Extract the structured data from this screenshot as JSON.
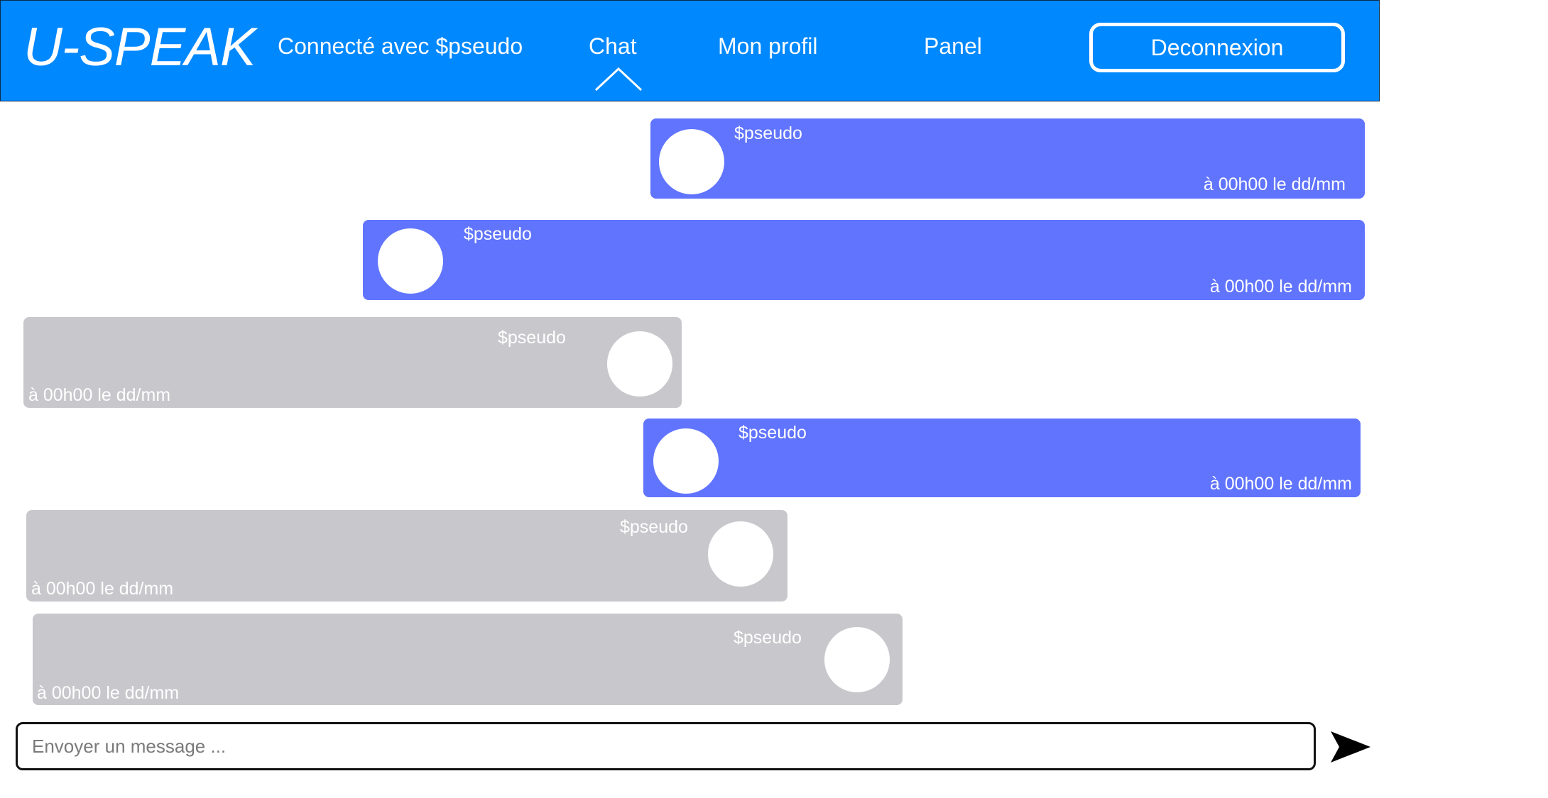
{
  "header": {
    "logo": "U-SPEAK",
    "connected_label": "Connecté avec $pseudo",
    "nav": {
      "chat": "Chat",
      "profile": "Mon profil",
      "panel": "Panel"
    },
    "active_tab": "Chat",
    "logout_label": "Deconnexion",
    "background_color": "#0088fe"
  },
  "messages": [
    {
      "side": "sent",
      "pseudo": "$pseudo",
      "time": "à 00h00 le dd/mm"
    },
    {
      "side": "sent",
      "pseudo": "$pseudo",
      "time": "à 00h00 le dd/mm"
    },
    {
      "side": "received",
      "pseudo": "$pseudo",
      "time": "à 00h00 le dd/mm"
    },
    {
      "side": "sent",
      "pseudo": "$pseudo",
      "time": "à 00h00 le dd/mm"
    },
    {
      "side": "received",
      "pseudo": "$pseudo",
      "time": "à 00h00 le dd/mm"
    },
    {
      "side": "received",
      "pseudo": "$pseudo",
      "time": "à 00h00 le dd/mm"
    }
  ],
  "colors": {
    "sent_bubble": "#6074fe",
    "received_bubble": "#c8c8cc"
  },
  "composer": {
    "placeholder": "Envoyer un message ...",
    "value": "",
    "send_icon": "send-arrow-icon"
  }
}
